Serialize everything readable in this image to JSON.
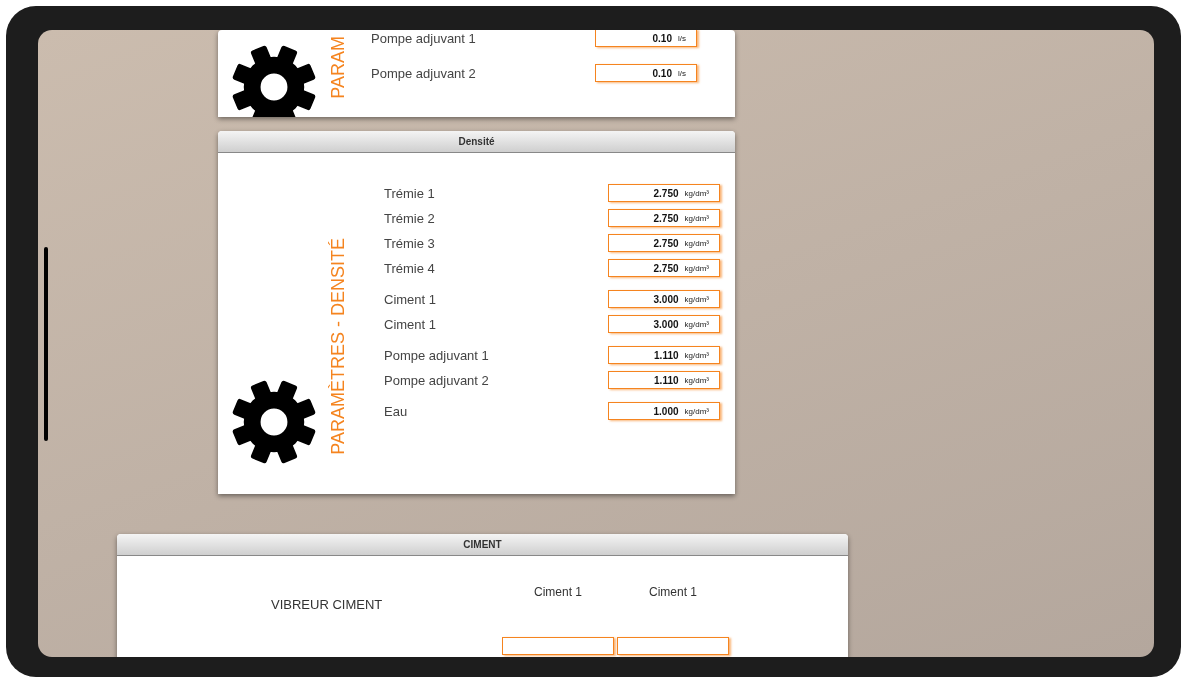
{
  "top_panel": {
    "vertical_title": "PARAM",
    "groups": [
      [
        {
          "label": "Pompe adjuvant 1",
          "value": "0.10",
          "unit": "l/s"
        }
      ],
      [
        {
          "label": "Pompe adjuvant 2",
          "value": "0.10",
          "unit": "l/s"
        }
      ]
    ]
  },
  "density_panel": {
    "title": "Densité",
    "vertical_title": "PARAMÈTRES - DENSITÉ",
    "groups": [
      [
        {
          "label": "Trémie 1",
          "value": "2.750",
          "unit": "kg/dm³"
        },
        {
          "label": "Trémie 2",
          "value": "2.750",
          "unit": "kg/dm³"
        },
        {
          "label": "Trémie 3",
          "value": "2.750",
          "unit": "kg/dm³"
        },
        {
          "label": "Trémie 4",
          "value": "2.750",
          "unit": "kg/dm³"
        }
      ],
      [
        {
          "label": "Ciment 1",
          "value": "3.000",
          "unit": "kg/dm³"
        },
        {
          "label": "Ciment 1",
          "value": "3.000",
          "unit": "kg/dm³"
        }
      ],
      [
        {
          "label": "Pompe adjuvant 1",
          "value": "1.110",
          "unit": "kg/dm³"
        },
        {
          "label": "Pompe adjuvant 2",
          "value": "1.110",
          "unit": "kg/dm³"
        }
      ],
      [
        {
          "label": "Eau",
          "value": "1.000",
          "unit": "kg/dm³"
        }
      ]
    ]
  },
  "cement_panel": {
    "title": "CIMENT",
    "section_label": "VIBREUR CIMENT",
    "columns": [
      "Ciment 1",
      "Ciment 1"
    ]
  }
}
